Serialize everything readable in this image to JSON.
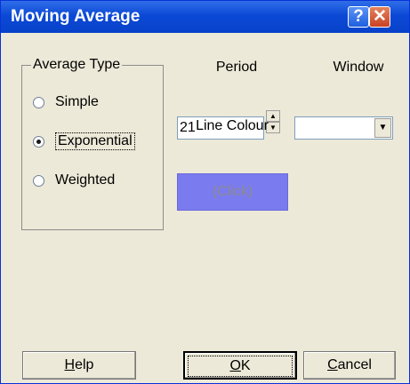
{
  "window": {
    "title": "Moving Average",
    "help_glyph": "?",
    "close_glyph": "✕"
  },
  "average_type": {
    "legend": "Average Type",
    "options": [
      {
        "label": "Simple",
        "selected": false
      },
      {
        "label": "Exponential",
        "selected": true
      },
      {
        "label": "Weighted",
        "selected": false
      }
    ]
  },
  "period": {
    "label": "Period",
    "value": "21"
  },
  "window_select": {
    "label": "Window",
    "value": ""
  },
  "line_colour": {
    "label": "Line Colour",
    "button_text": "(Click)",
    "color": "#7b7bf0"
  },
  "buttons": {
    "help": {
      "accel": "H",
      "rest": "elp"
    },
    "ok": {
      "accel": "O",
      "rest": "K"
    },
    "cancel": {
      "accel": "C",
      "rest": "ancel"
    }
  }
}
